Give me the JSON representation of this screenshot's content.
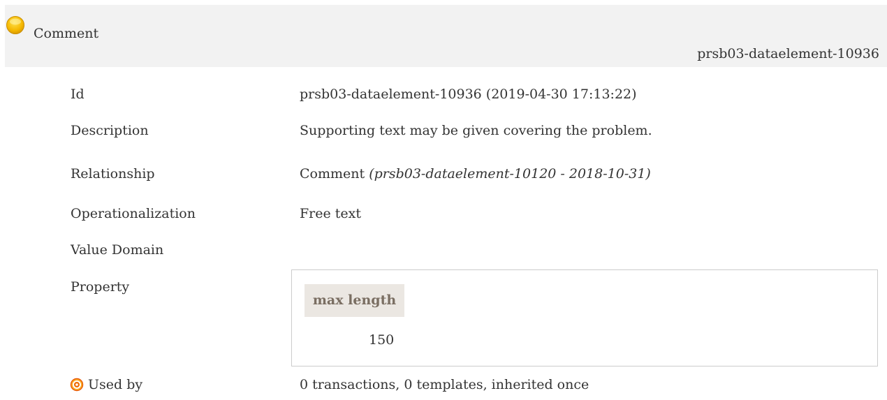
{
  "header": {
    "title": "Comment",
    "id_label": "prsb03-dataelement-10936",
    "status_color": "#f5b800",
    "status_icon": "status-circle-icon"
  },
  "rows": {
    "id": {
      "label": "Id",
      "value": "prsb03-dataelement-10936 (2019-04-30 17:13:22)"
    },
    "description": {
      "label": "Description",
      "value": "Supporting text may be given covering the problem."
    },
    "relationship": {
      "label": "Relationship",
      "value": "Comment",
      "detail": "(prsb03-dataelement-10120 - 2018-10-31)"
    },
    "operationalization": {
      "label": "Operationalization",
      "value": "Free text"
    },
    "value_domain": {
      "label": "Value Domain"
    },
    "property": {
      "label": "Property",
      "column_header": "max length",
      "value": "150"
    },
    "used_by": {
      "label": "Used by",
      "icon": "target-icon",
      "value": "0 transactions, 0 templates, inherited once"
    }
  }
}
